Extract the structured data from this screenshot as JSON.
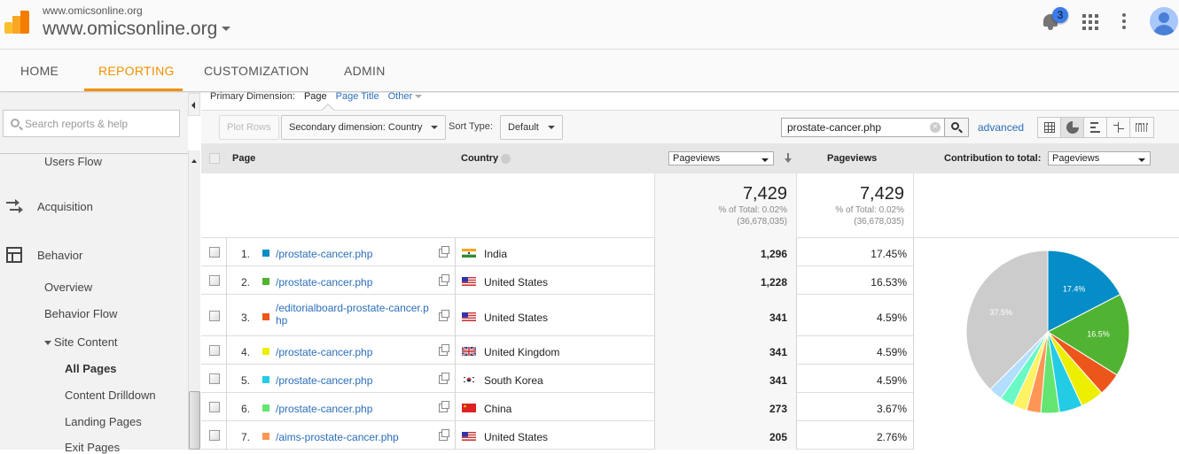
{
  "header": {
    "account_small": "www.omicsonline.org",
    "account_big": "www.omicsonline.org",
    "notification_count": "3"
  },
  "nav": {
    "tabs": [
      {
        "label": "HOME"
      },
      {
        "label": "REPORTING",
        "active": true
      },
      {
        "label": "CUSTOMIZATION"
      },
      {
        "label": "ADMIN"
      }
    ]
  },
  "sidebar": {
    "search_placeholder": "Search reports & help",
    "items": {
      "users_flow": "Users Flow",
      "acquisition": "Acquisition",
      "behavior": "Behavior",
      "overview": "Overview",
      "behavior_flow": "Behavior Flow",
      "site_content": "Site Content",
      "all_pages": "All Pages",
      "content_drilldown": "Content Drilldown",
      "landing_pages": "Landing Pages",
      "exit_pages": "Exit Pages"
    }
  },
  "primary_dimension": {
    "label": "Primary Dimension:",
    "current": "Page",
    "options": [
      "Page Title",
      "Other"
    ]
  },
  "toolbar": {
    "plot_rows": "Plot Rows",
    "secondary_dimension": "Secondary dimension: Country",
    "sort_type_label": "Sort Type:",
    "sort_type_value": "Default",
    "filter_value": "prostate-cancer.php",
    "advanced": "advanced"
  },
  "table": {
    "headers": {
      "page": "Page",
      "country": "Country",
      "metric_select": "Pageviews",
      "pageviews": "Pageviews",
      "contribution_label": "Contribution to total:",
      "contribution_select": "Pageviews"
    },
    "summary": [
      {
        "value": "7,429",
        "pct": "% of Total: 0.02%",
        "total": "(36,678,035)"
      },
      {
        "value": "7,429",
        "pct": "% of Total: 0.02%",
        "total": "(36,678,035)"
      }
    ],
    "rows": [
      {
        "idx": "1.",
        "color": "#058dc7",
        "page": "/prostate-cancer.php",
        "country": "India",
        "flag": "in",
        "pageviews": "1,296",
        "pct": "17.45%"
      },
      {
        "idx": "2.",
        "color": "#50b432",
        "page": "/prostate-cancer.php",
        "country": "United States",
        "flag": "us",
        "pageviews": "1,228",
        "pct": "16.53%"
      },
      {
        "idx": "3.",
        "color": "#ed561b",
        "page": "/editorialboard-prostate-cancer.php",
        "country": "United States",
        "flag": "us",
        "pageviews": "341",
        "pct": "4.59%"
      },
      {
        "idx": "4.",
        "color": "#edef00",
        "page": "/prostate-cancer.php",
        "country": "United Kingdom",
        "flag": "gb",
        "pageviews": "341",
        "pct": "4.59%"
      },
      {
        "idx": "5.",
        "color": "#24cbe5",
        "page": "/prostate-cancer.php",
        "country": "South Korea",
        "flag": "kr",
        "pageviews": "341",
        "pct": "4.59%"
      },
      {
        "idx": "6.",
        "color": "#64e572",
        "page": "/prostate-cancer.php",
        "country": "China",
        "flag": "cn",
        "pageviews": "273",
        "pct": "3.67%"
      },
      {
        "idx": "7.",
        "color": "#ff9655",
        "page": "/aims-prostate-cancer.php",
        "country": "United States",
        "flag": "us",
        "pageviews": "205",
        "pct": "2.76%"
      }
    ]
  },
  "chart_data": {
    "type": "pie",
    "title": "Contribution to total: Pageviews",
    "slices": [
      {
        "label": "1",
        "value": 17.4,
        "color": "#058dc7",
        "show_label": "17.4%"
      },
      {
        "label": "2",
        "value": 16.5,
        "color": "#50b432",
        "show_label": "16.5%"
      },
      {
        "label": "3",
        "value": 4.6,
        "color": "#ed561b"
      },
      {
        "label": "4",
        "value": 4.6,
        "color": "#edef00"
      },
      {
        "label": "5",
        "value": 4.6,
        "color": "#24cbe5"
      },
      {
        "label": "6",
        "value": 3.7,
        "color": "#64e572"
      },
      {
        "label": "7",
        "value": 2.8,
        "color": "#ff9655"
      },
      {
        "label": "8",
        "value": 2.8,
        "color": "#fff263"
      },
      {
        "label": "9",
        "value": 2.8,
        "color": "#6af9c4"
      },
      {
        "label": "10",
        "value": 2.7,
        "color": "#b2deff"
      },
      {
        "label": "Other",
        "value": 37.5,
        "color": "#cccccc",
        "show_label": "37.5%"
      }
    ]
  }
}
